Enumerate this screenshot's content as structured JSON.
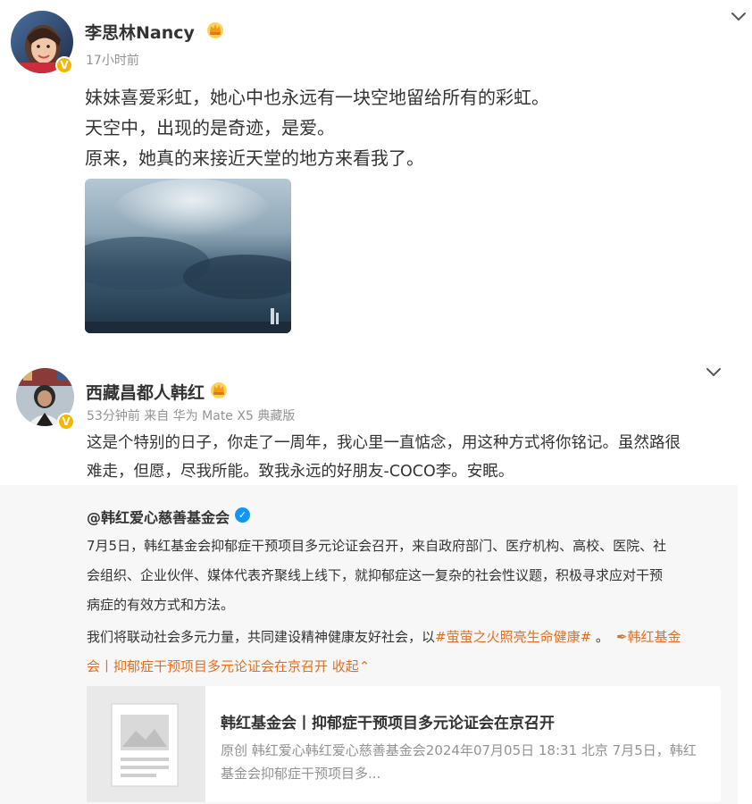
{
  "post1": {
    "username": "李思林Nancy",
    "time": "17小时前",
    "lines": [
      "妹妹喜爱彩虹，她心中也永远有一块空地留给所有的彩虹。",
      "天空中，出现的是奇迹，是爱。",
      "原来，她真的来接近天堂的地方来看我了。"
    ],
    "avatar_icon": "avatar-photo",
    "crown_icon": "member-crown-icon",
    "more_icon": "chevron-down-icon"
  },
  "post2": {
    "username": "西藏昌都人韩红",
    "meta": "53分钟前  来自 华为 Mate X5 典藏版",
    "lines": [
      "这是个特别的日子，你走了一周年，我心里一直惦念，用这种方式将你铭记。虽然路很",
      "难走，但愿，尽我所能。致我永远的好朋友-COCO李。安眠。"
    ],
    "repost": {
      "username": "@韩红爱心慈善基金会",
      "lines": [
        "7月5日，韩红基金会抑郁症干预项目多元论证会召开，来自政府部门、医疗机构、高校、医院、社",
        "会组织、企业伙伴、媒体代表齐聚线上线下，就抑郁症这一复杂的社会性议题，积极寻求应对干预",
        "病症的有效方式和方法。"
      ],
      "line4_plain": "我们将联动社会多元力量，共同建设精神健康友好社会，以",
      "line4_hashtag": "#萤萤之火照亮生命健康#",
      "line4_sep": " 。",
      "line4_link": "韩红基金",
      "line5_link": "会丨抑郁症干预项目多元论证会在京召开",
      "line5_collapse": " 收起",
      "card": {
        "title": "韩红基金会丨抑郁症干预项目多元论证会在京召开",
        "desc_line1": "原创 韩红爱心韩红爱心慈善基金会2024年07月05日 18:31 北京 7月5日，韩红",
        "desc_line2": "基金会抑郁症干预项目多..."
      }
    }
  },
  "colors": {
    "highlight": "#e86d1c",
    "meta_gray": "#939393",
    "repost_bg": "#f7f7f7",
    "verified_yellow": "#f7b500",
    "verified_blue": "#1296f5"
  }
}
